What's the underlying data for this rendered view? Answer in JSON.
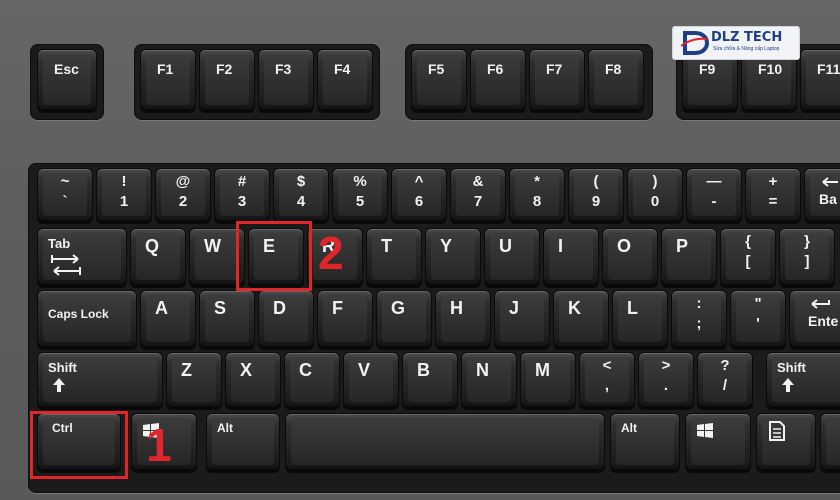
{
  "colors": {
    "highlight": "#e0262a",
    "key_face": "#1c1c1c",
    "key_label": "#f2f2f2",
    "case": "#5f5f5f"
  },
  "logo": {
    "brand": "DLZ TECH",
    "tagline": "Sửa chữa & Nâng cấp Laptop"
  },
  "keys": {
    "esc": "Esc",
    "f1": "F1",
    "f2": "F2",
    "f3": "F3",
    "f4": "F4",
    "f5": "F5",
    "f6": "F6",
    "f7": "F7",
    "f8": "F8",
    "f9": "F9",
    "f10": "F10",
    "f11": "F11",
    "tilde": {
      "top": "~",
      "bottom": "`"
    },
    "n1": {
      "top": "!",
      "bottom": "1"
    },
    "n2": {
      "top": "@",
      "bottom": "2"
    },
    "n3": {
      "top": "#",
      "bottom": "3"
    },
    "n4": {
      "top": "$",
      "bottom": "4"
    },
    "n5": {
      "top": "%",
      "bottom": "5"
    },
    "n6": {
      "top": "^",
      "bottom": "6"
    },
    "n7": {
      "top": "&",
      "bottom": "7"
    },
    "n8": {
      "top": "*",
      "bottom": "8"
    },
    "n9": {
      "top": "(",
      "bottom": "9"
    },
    "n0": {
      "top": ")",
      "bottom": "0"
    },
    "minus": {
      "top": "—",
      "bottom": "-"
    },
    "equals": {
      "top": "+",
      "bottom": "="
    },
    "backspace": "Ba",
    "tab": "Tab",
    "q": "Q",
    "w": "W",
    "e": "E",
    "r": "R",
    "t": "T",
    "y": "Y",
    "u": "U",
    "i": "I",
    "o": "O",
    "p": "P",
    "lbracket": {
      "top": "{",
      "bottom": "["
    },
    "rbracket": {
      "top": "}",
      "bottom": "]"
    },
    "capslock": "Caps Lock",
    "a": "A",
    "s": "S",
    "d": "D",
    "f": "F",
    "g": "G",
    "h": "H",
    "j": "J",
    "k": "K",
    "l": "L",
    "semicolon": {
      "top": ":",
      "bottom": ";"
    },
    "quote": {
      "top": "\"",
      "bottom": "'"
    },
    "enter": "Ente",
    "lshift": "Shift",
    "z": "Z",
    "x": "X",
    "c": "C",
    "v": "V",
    "b": "B",
    "n": "N",
    "m": "M",
    "comma": {
      "top": "<",
      "bottom": ","
    },
    "period": {
      "top": ">",
      "bottom": "."
    },
    "slash": {
      "top": "?",
      "bottom": "/"
    },
    "rshift": "Shift",
    "ctrl": "Ctrl",
    "lalt": "Alt",
    "ralt": "Alt"
  },
  "annotations": [
    {
      "label": "1",
      "key": "Ctrl"
    },
    {
      "label": "2",
      "key": "E"
    }
  ]
}
